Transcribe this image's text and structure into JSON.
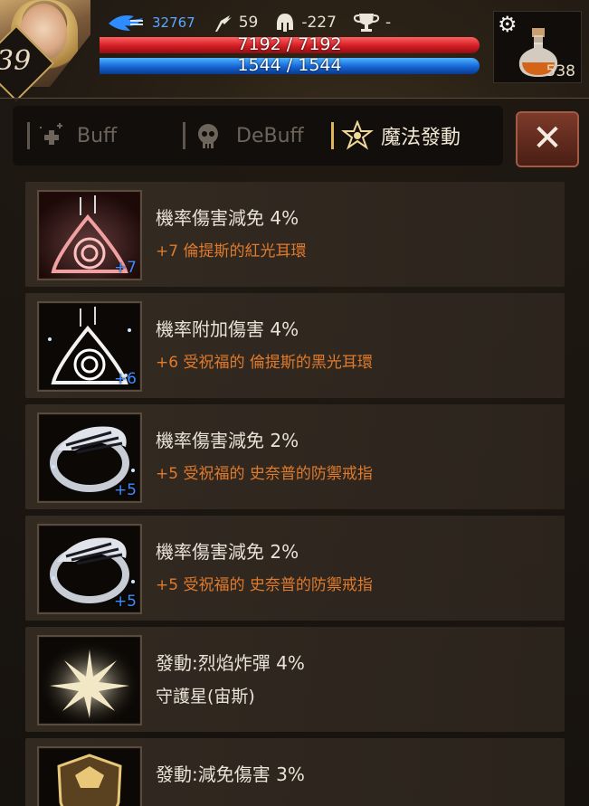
{
  "hud": {
    "level": "39",
    "exp": "32767",
    "stat_attack": "59",
    "stat_defense": "-227",
    "stat_trophy": "-",
    "hp": "7192 / 7192",
    "mp": "1544 / 1544",
    "hp_fill": 1.0,
    "mp_fill": 1.0,
    "potion_count": "538"
  },
  "tabs": {
    "buff": "Buff",
    "debuff": "DeBuff",
    "magic": "魔法發動"
  },
  "close_label": "✕",
  "effects": [
    {
      "title": "機率傷害減免 4%",
      "source": "+7 倫提斯的紅光耳環",
      "enhance": "+7",
      "icon": "red-earring-icon",
      "source_color": "#e07a2c"
    },
    {
      "title": "機率附加傷害 4%",
      "source": "+6 受祝福的 倫提斯的黑光耳環",
      "enhance": "+6",
      "icon": "white-earring-icon",
      "source_color": "#e07a2c"
    },
    {
      "title": "機率傷害減免 2%",
      "source": "+5 受祝福的 史奈普的防禦戒指",
      "enhance": "+5",
      "icon": "ring-icon",
      "source_color": "#e07a2c"
    },
    {
      "title": "機率傷害減免 2%",
      "source": "+5 受祝福的 史奈普的防禦戒指",
      "enhance": "+5",
      "icon": "ring-icon",
      "source_color": "#e07a2c"
    },
    {
      "title": "發動:烈焰炸彈 4%",
      "source": "守護星(宙斯)",
      "enhance": "",
      "icon": "star-burst-icon",
      "source_color": "#e9e2d6"
    },
    {
      "title": "發動:減免傷害 3%",
      "source": "",
      "enhance": "",
      "icon": "shield-crest-icon",
      "source_color": "#e9e2d6"
    }
  ]
}
